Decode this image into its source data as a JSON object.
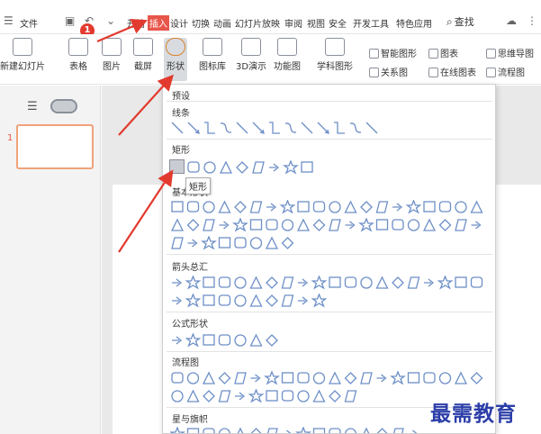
{
  "menubar": {
    "file_label": "文件",
    "tabs": [
      "开始",
      "插入",
      "设计",
      "切换",
      "动画",
      "幻灯片放映",
      "审阅",
      "视图",
      "安全",
      "开发工具",
      "特色应用"
    ],
    "active_tab": "插入",
    "search_label": "查找",
    "badge": "1"
  },
  "toolbar": {
    "new_slide": "新建幻灯片",
    "table": "表格",
    "picture": "图片",
    "screenshot": "截屏",
    "shape": "形状",
    "icon_lib": "图标库",
    "demo3d": "3D演示",
    "function_chart": "功能图",
    "subject_shape": "学科图形",
    "smart_shape": "智能图形",
    "chart": "图表",
    "mindmap": "思维导图",
    "relation_chart": "关系图",
    "online_chart": "在线图表",
    "flowchart": "流程图"
  },
  "panel": {
    "slide_number": "1"
  },
  "dropdown": {
    "preset": "预设",
    "sections": {
      "lines": "线条",
      "rect": "矩形",
      "basic": "基本形状",
      "arrows": "箭头总汇",
      "formula": "公式形状",
      "flow": "流程图",
      "stars": "星与旗帜"
    },
    "tooltip": "矩形"
  },
  "watermark": "最需教育",
  "colors": {
    "accent": "#e8564b",
    "arrow": "#e23a2e",
    "shape_blue": "#6d8fc7",
    "watermark": "#2c3ea8"
  }
}
